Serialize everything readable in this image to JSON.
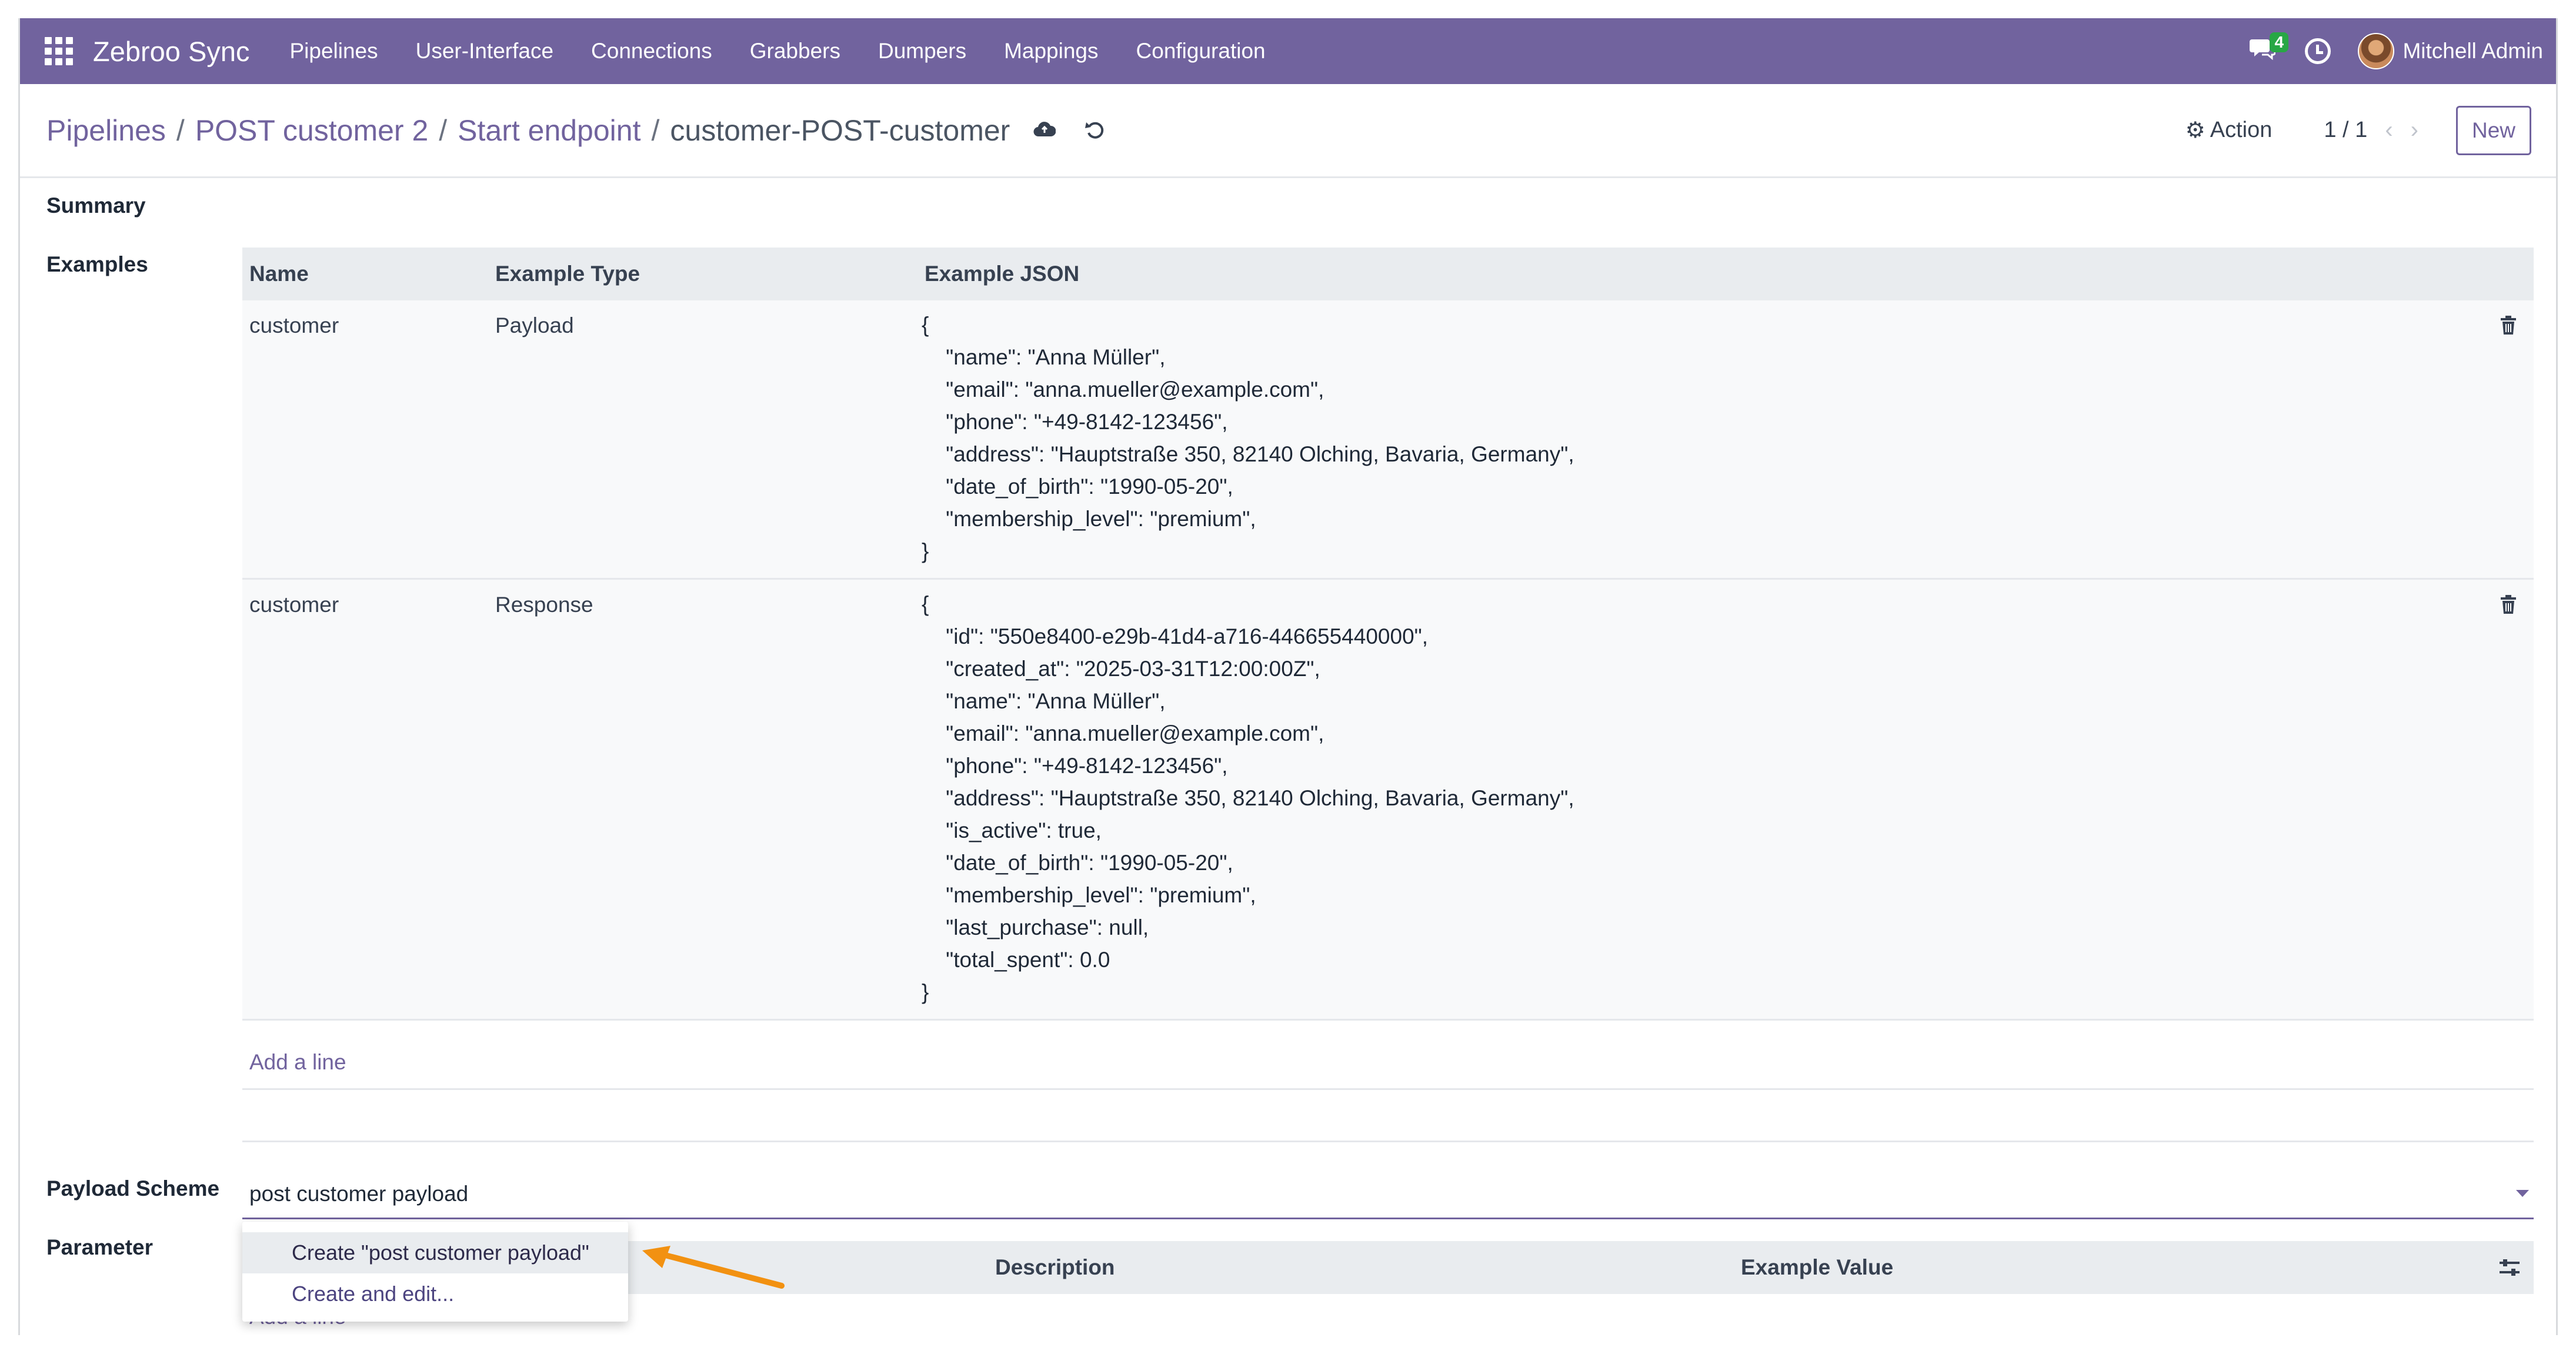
{
  "navbar": {
    "brand": "Zebroo Sync",
    "menu": [
      "Pipelines",
      "User-Interface",
      "Connections",
      "Grabbers",
      "Dumpers",
      "Mappings",
      "Configuration"
    ],
    "chat_count": "4",
    "user_name": "Mitchell Admin"
  },
  "breadcrumb": {
    "items": [
      "Pipelines",
      "POST customer 2",
      "Start endpoint"
    ],
    "separator": "/",
    "current": "customer-POST-customer"
  },
  "control": {
    "action_label": "Action",
    "pager": "1 / 1",
    "new_label": "New"
  },
  "form": {
    "summary_label": "Summary",
    "examples_label": "Examples",
    "payload_scheme_label": "Payload Scheme",
    "parameter_label": "Parameter"
  },
  "examples_table": {
    "columns": [
      "Name",
      "Example Type",
      "Example JSON"
    ],
    "rows": [
      {
        "name": "customer",
        "type": "Payload",
        "json": "{\n    \"name\": \"Anna Müller\",\n    \"email\": \"anna.mueller@example.com\",\n    \"phone\": \"+49-8142-123456\",\n    \"address\": \"Hauptstraße 350, 82140 Olching, Bavaria, Germany\",\n    \"date_of_birth\": \"1990-05-20\",\n    \"membership_level\": \"premium\",\n}"
      },
      {
        "name": "customer",
        "type": "Response",
        "json": "{\n    \"id\": \"550e8400-e29b-41d4-a716-446655440000\",\n    \"created_at\": \"2025-03-31T12:00:00Z\",\n    \"name\": \"Anna Müller\",\n    \"email\": \"anna.mueller@example.com\",\n    \"phone\": \"+49-8142-123456\",\n    \"address\": \"Hauptstraße 350, 82140 Olching, Bavaria, Germany\",\n    \"is_active\": true,\n    \"date_of_birth\": \"1990-05-20\",\n    \"membership_level\": \"premium\",\n    \"last_purchase\": null,\n    \"total_spent\": 0.0\n}"
      }
    ],
    "add_line": "Add a line"
  },
  "payload_scheme": {
    "value": "post customer payload",
    "dropdown": [
      "Create \"post customer payload\"",
      "Create and edit..."
    ]
  },
  "parameter_table": {
    "columns": [
      "Description",
      "Example Value"
    ],
    "add_line": "Add a line"
  },
  "colors": {
    "brand": "#71639e",
    "annotation_arrow": "#f29111"
  }
}
